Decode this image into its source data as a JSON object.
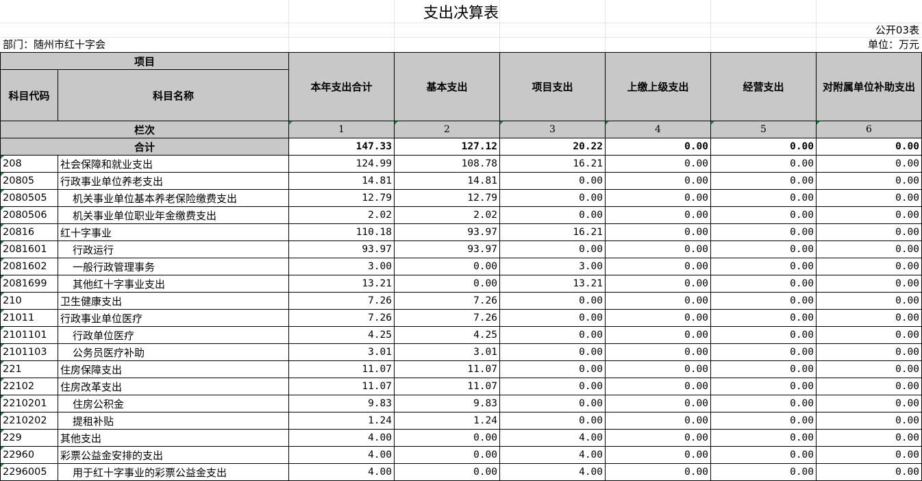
{
  "title": "支出决算表",
  "form_no": "公开03表",
  "department": "部门：随州市红十字会",
  "unit": "单位：万元",
  "headers": {
    "item": "项目",
    "code": "科目代码",
    "name": "科目名称",
    "columns": [
      "本年支出合计",
      "基本支出",
      "项目支出",
      "上缴上级支出",
      "经营支出",
      "对附属单位补助支出"
    ]
  },
  "index_row": {
    "label": "栏次",
    "numbers": [
      "1",
      "2",
      "3",
      "4",
      "5",
      "6"
    ]
  },
  "total_row": {
    "label": "合计",
    "values": [
      "147.33",
      "127.12",
      "20.22",
      "0.00",
      "0.00",
      "0.00"
    ]
  },
  "rows": [
    {
      "code": "208",
      "name": "社会保障和就业支出",
      "values": [
        "124.99",
        "108.78",
        "16.21",
        "0.00",
        "0.00",
        "0.00"
      ]
    },
    {
      "code": "20805",
      "name": "行政事业单位养老支出",
      "values": [
        "14.81",
        "14.81",
        "0.00",
        "0.00",
        "0.00",
        "0.00"
      ]
    },
    {
      "code": "2080505",
      "name": "机关事业单位基本养老保险缴费支出",
      "values": [
        "12.79",
        "12.79",
        "0.00",
        "0.00",
        "0.00",
        "0.00"
      ]
    },
    {
      "code": "2080506",
      "name": "机关事业单位职业年金缴费支出",
      "values": [
        "2.02",
        "2.02",
        "0.00",
        "0.00",
        "0.00",
        "0.00"
      ]
    },
    {
      "code": "20816",
      "name": "红十字事业",
      "values": [
        "110.18",
        "93.97",
        "16.21",
        "0.00",
        "0.00",
        "0.00"
      ]
    },
    {
      "code": "2081601",
      "name": "行政运行",
      "values": [
        "93.97",
        "93.97",
        "0.00",
        "0.00",
        "0.00",
        "0.00"
      ]
    },
    {
      "code": "2081602",
      "name": "一般行政管理事务",
      "values": [
        "3.00",
        "0.00",
        "3.00",
        "0.00",
        "0.00",
        "0.00"
      ]
    },
    {
      "code": "2081699",
      "name": "其他红十字事业支出",
      "values": [
        "13.21",
        "0.00",
        "13.21",
        "0.00",
        "0.00",
        "0.00"
      ]
    },
    {
      "code": "210",
      "name": "卫生健康支出",
      "values": [
        "7.26",
        "7.26",
        "0.00",
        "0.00",
        "0.00",
        "0.00"
      ]
    },
    {
      "code": "21011",
      "name": "行政事业单位医疗",
      "values": [
        "7.26",
        "7.26",
        "0.00",
        "0.00",
        "0.00",
        "0.00"
      ]
    },
    {
      "code": "2101101",
      "name": "行政单位医疗",
      "values": [
        "4.25",
        "4.25",
        "0.00",
        "0.00",
        "0.00",
        "0.00"
      ]
    },
    {
      "code": "2101103",
      "name": "公务员医疗补助",
      "values": [
        "3.01",
        "3.01",
        "0.00",
        "0.00",
        "0.00",
        "0.00"
      ]
    },
    {
      "code": "221",
      "name": "住房保障支出",
      "values": [
        "11.07",
        "11.07",
        "0.00",
        "0.00",
        "0.00",
        "0.00"
      ]
    },
    {
      "code": "22102",
      "name": "住房改革支出",
      "values": [
        "11.07",
        "11.07",
        "0.00",
        "0.00",
        "0.00",
        "0.00"
      ]
    },
    {
      "code": "2210201",
      "name": "住房公积金",
      "values": [
        "9.83",
        "9.83",
        "0.00",
        "0.00",
        "0.00",
        "0.00"
      ]
    },
    {
      "code": "2210202",
      "name": "提租补贴",
      "values": [
        "1.24",
        "1.24",
        "0.00",
        "0.00",
        "0.00",
        "0.00"
      ]
    },
    {
      "code": "229",
      "name": "其他支出",
      "values": [
        "4.00",
        "0.00",
        "4.00",
        "0.00",
        "0.00",
        "0.00"
      ]
    },
    {
      "code": "22960",
      "name": "彩票公益金安排的支出",
      "values": [
        "4.00",
        "0.00",
        "4.00",
        "0.00",
        "0.00",
        "0.00"
      ]
    },
    {
      "code": "2296005",
      "name": "用于红十字事业的彩票公益金支出",
      "values": [
        "4.00",
        "0.00",
        "4.00",
        "0.00",
        "0.00",
        "0.00"
      ]
    }
  ],
  "colors": {
    "header_bg": "#c8c8c8",
    "marker": "#1a8a3a",
    "grid": "#e3e3e3"
  }
}
